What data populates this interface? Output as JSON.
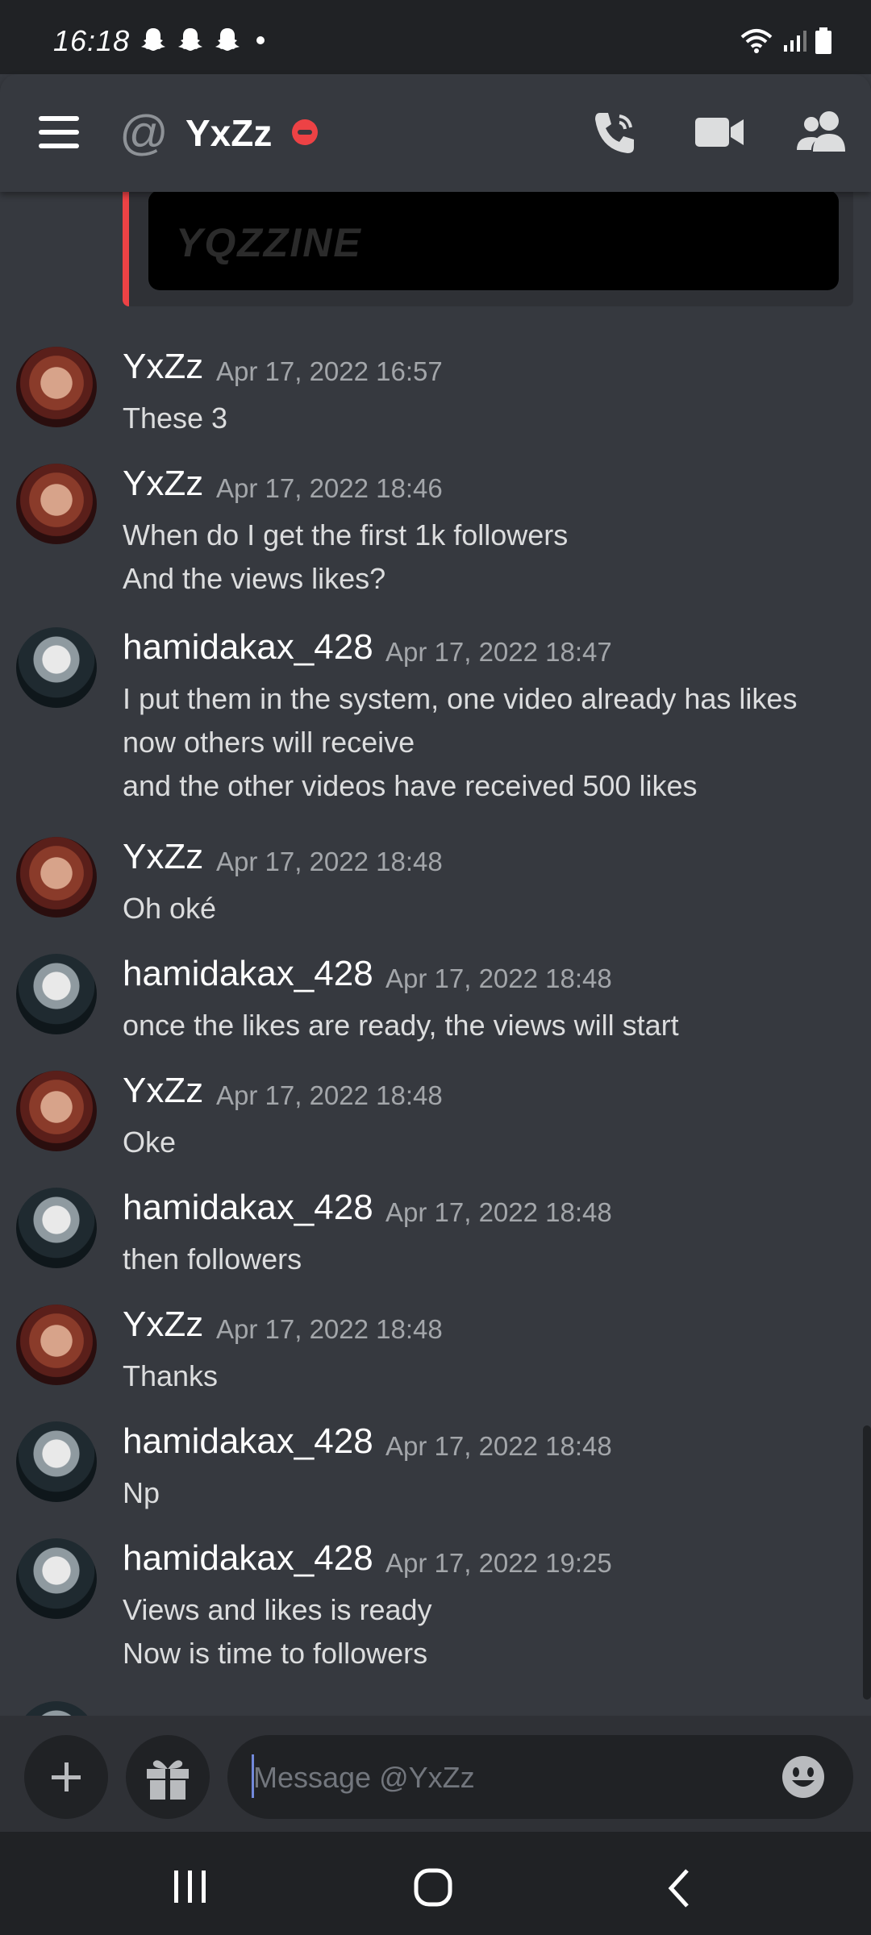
{
  "status_bar": {
    "time": "16:18"
  },
  "header": {
    "channel_symbol": "@",
    "title": "YxZz"
  },
  "embed": {
    "image_text": "YQZZINE"
  },
  "messages": [
    {
      "author": "YxZz",
      "timestamp": "Apr 17, 2022 16:57",
      "lines": [
        "These 3"
      ]
    },
    {
      "author": "YxZz",
      "timestamp": "Apr 17, 2022 18:46",
      "lines": [
        "When do I get the first 1k followers",
        "And the views likes?"
      ]
    },
    {
      "author": "hamidakax_428",
      "timestamp": "Apr 17, 2022 18:47",
      "lines": [
        "I put them in the system, one video already has likes",
        "now others will receive",
        "and the other videos have received 500 likes"
      ]
    },
    {
      "author": "YxZz",
      "timestamp": "Apr 17, 2022 18:48",
      "lines": [
        "Oh oké"
      ]
    },
    {
      "author": "hamidakax_428",
      "timestamp": "Apr 17, 2022 18:48",
      "lines": [
        "once the likes are ready, the views will start"
      ]
    },
    {
      "author": "YxZz",
      "timestamp": "Apr 17, 2022 18:48",
      "lines": [
        "Oke"
      ]
    },
    {
      "author": "hamidakax_428",
      "timestamp": "Apr 17, 2022 18:48",
      "lines": [
        "then followers"
      ]
    },
    {
      "author": "YxZz",
      "timestamp": "Apr 17, 2022 18:48",
      "lines": [
        "Thanks"
      ]
    },
    {
      "author": "hamidakax_428",
      "timestamp": "Apr 17, 2022 18:48",
      "lines": [
        "Np"
      ]
    },
    {
      "author": "hamidakax_428",
      "timestamp": "Apr 17, 2022 19:25",
      "lines": [
        "Views and likes is ready",
        "Now is time to followers"
      ]
    }
  ],
  "composer": {
    "placeholder": "Message @YxZz"
  },
  "colors": {
    "background": "#36393f",
    "header_bg": "#36393f",
    "status_bar": "#202225",
    "dnd_status": "#ed4245",
    "embed_border": "#ed4245"
  }
}
